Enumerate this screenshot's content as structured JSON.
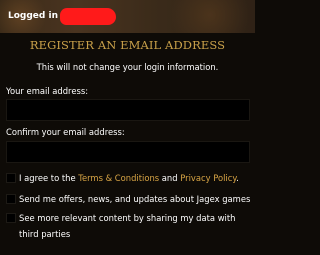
{
  "header": {
    "logged_in_label": "Logged in as:"
  },
  "form": {
    "title": "REGISTER AN EMAIL ADDRESS",
    "subtitle": "This will not change your login information.",
    "email_label": "Your email address:",
    "email_value": "",
    "confirm_label": "Confirm your email address:",
    "confirm_value": ""
  },
  "checkboxes": {
    "terms_prefix": "I agree to the ",
    "terms_link": "Terms & Conditions",
    "terms_mid": " and ",
    "privacy_link": "Privacy Policy",
    "terms_suffix": ".",
    "offers": "Send me offers, news, and updates about Jagex games",
    "sharing": "See more relevant content by sharing my data with third parties"
  },
  "colors": {
    "title": "#c9a14a",
    "link": "#d8a545",
    "background": "#0e0b07",
    "redaction": "#ff1a1a"
  }
}
